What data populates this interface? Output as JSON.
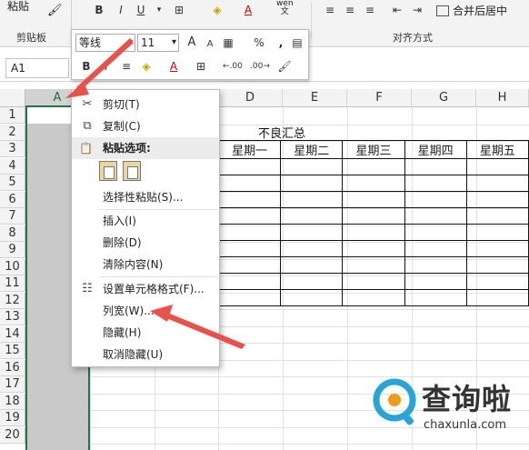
{
  "ribbon": {
    "paste_label": "粘贴",
    "clipboard_group": "剪贴板",
    "bold": "B",
    "italic": "I",
    "underline": "U",
    "wen_label": "wén\n文",
    "merge_label": "合并后居中",
    "alignment_group": "对齐方式"
  },
  "namebox": {
    "value": "A1"
  },
  "mini_toolbar": {
    "font": "等线",
    "size": "11",
    "grow": "A",
    "shrink": "A",
    "percent": "%",
    "comma": ",",
    "bold": "B",
    "italic": "I",
    "dec_inc": "←.00",
    "dec_dec": ".00→"
  },
  "columns": [
    "A",
    "B",
    "C",
    "D",
    "E",
    "F",
    "G",
    "H"
  ],
  "rows": [
    "1",
    "2",
    "3",
    "4",
    "5",
    "6",
    "7",
    "8",
    "9",
    "10",
    "11",
    "12",
    "13",
    "14",
    "15",
    "16",
    "17",
    "18",
    "19",
    "20"
  ],
  "sheet": {
    "title": "不良汇总",
    "table_headers": [
      "星期一",
      "星期二",
      "星期三",
      "星期四",
      "星期五"
    ]
  },
  "context_menu": {
    "cut": "剪切(T)",
    "copy": "复制(C)",
    "paste_options": "粘贴选项:",
    "paste_special": "选择性粘贴(S)...",
    "insert": "插入(I)",
    "delete": "删除(D)",
    "clear": "清除内容(N)",
    "format_cells": "设置单元格格式(F)...",
    "column_width": "列宽(W)...",
    "hide": "隐藏(H)",
    "unhide": "取消隐藏(U)"
  },
  "watermark": {
    "brand": "查询啦",
    "domain": "chaxunla.com"
  },
  "colors": {
    "accent": "#217346",
    "arrow": "#e8524a",
    "selected_col": "#c9c9c9"
  }
}
